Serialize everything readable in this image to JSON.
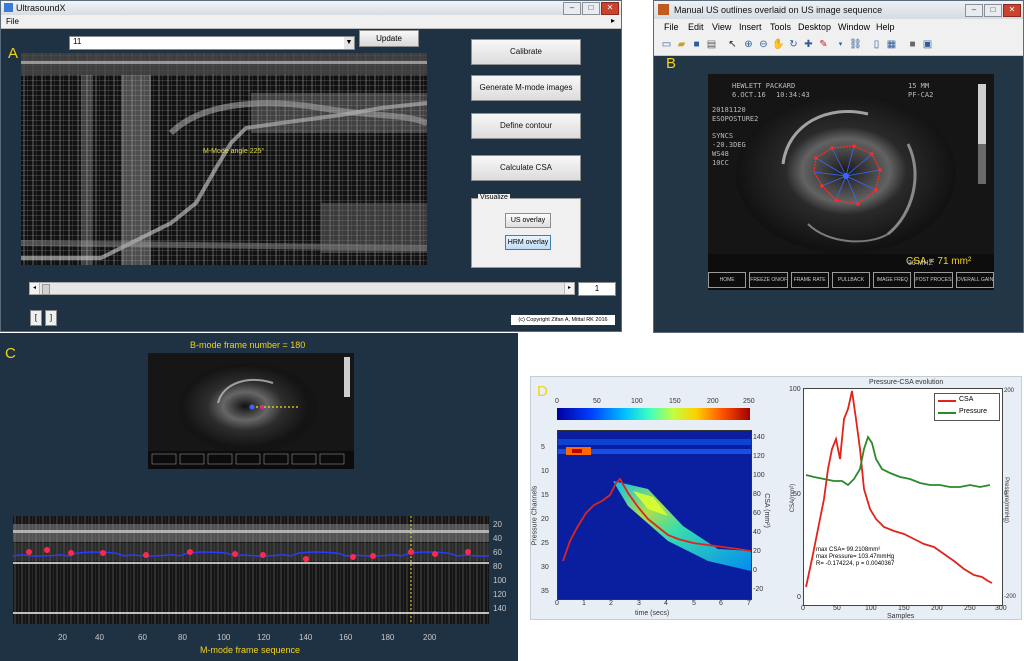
{
  "labels": {
    "a": "A",
    "b": "B",
    "c": "C",
    "d": "D"
  },
  "win_a": {
    "title": "UltrasoundX",
    "menu_file": "File",
    "dropdown_value": "11",
    "update_label": "Update",
    "buttons": [
      "Calibrate",
      "Generate M-mode images",
      "Define contour",
      "Calculate CSA"
    ],
    "mmode_angle": "M-Mode angle 225°",
    "visualize_title": "Visualize",
    "us_overlay": "US overlay",
    "hrm_overlay": "HRM overlay",
    "frame_value": "1",
    "copyright": "(c) Copyright Zifan A, Mittal RK 2016"
  },
  "win_b": {
    "title": "Manual US outlines overlaid on US image sequence",
    "menu": [
      "File",
      "Edit",
      "View",
      "Insert",
      "Tools",
      "Desktop",
      "Window",
      "Help"
    ],
    "overlay_header": "HEWLETT PACKARD",
    "overlay_lines": [
      "6.OCT.16",
      "10:34:43",
      "20181120",
      "ESOPOSTURE2",
      "SYNCS",
      "-20.3DEG",
      "WS48",
      "10CC"
    ],
    "overlay_right": [
      "15 MM",
      "PF-CA2"
    ],
    "csa_text": "CSA = 71 mm²",
    "bottom_buttons": [
      "HOME",
      "FREEZE ON/OFF",
      "FRAME RATE",
      "PULLBACK",
      "IMAGE FREQ",
      "POST PROCESS",
      "OVERALL GAIN"
    ],
    "bottom_value": "30 MHZ"
  },
  "panel_c": {
    "title": "B-mode frame number = 180",
    "xlabel": "M-mode frame sequence",
    "x_ticks": [
      "20",
      "40",
      "60",
      "80",
      "100",
      "120",
      "140",
      "160",
      "180",
      "200"
    ],
    "y_ticks": [
      "20",
      "40",
      "60",
      "80",
      "100",
      "120",
      "140"
    ]
  },
  "panel_d": {
    "colorbar_ticks": [
      "0",
      "50",
      "100",
      "150",
      "200",
      "250"
    ],
    "heatmap_ylabel": "Pressure Channels",
    "heatmap_y2label": "CSA (mm²)",
    "heatmap_xlabel": "time (secs)",
    "heatmap_x_ticks": [
      "0",
      "1",
      "2",
      "3",
      "4",
      "5",
      "6",
      "7"
    ],
    "heatmap_y_ticks": [
      "5",
      "10",
      "15",
      "20",
      "25",
      "30",
      "35"
    ],
    "heatmap_y2_ticks": [
      "140",
      "120",
      "100",
      "80",
      "60",
      "40",
      "20",
      "0",
      "-20"
    ],
    "evo_title": "Pressure-CSA evolution",
    "legend": [
      "CSA",
      "Pressure"
    ],
    "evo_ylabel": "CSA(mm²)",
    "evo_y2label": "Pressure(mmHg)",
    "evo_xlabel": "Samples",
    "evo_x_ticks": [
      "0",
      "50",
      "100",
      "150",
      "200",
      "250",
      "300"
    ],
    "evo_y_ticks": [
      "100",
      "50",
      "0"
    ],
    "evo_y2_ticks": [
      "200",
      "0",
      "-200"
    ],
    "stats": [
      "max CSA= 99.2108mm²",
      "max Pressure= 103.47mmHg",
      "R= -0.174224, p = 0.0040367"
    ]
  },
  "colors": {
    "panel_bg": "#1f3244",
    "label_yellow": "#f2d21a",
    "csa_red": "#e0241b",
    "pressure_green": "#2a8a2a"
  }
}
